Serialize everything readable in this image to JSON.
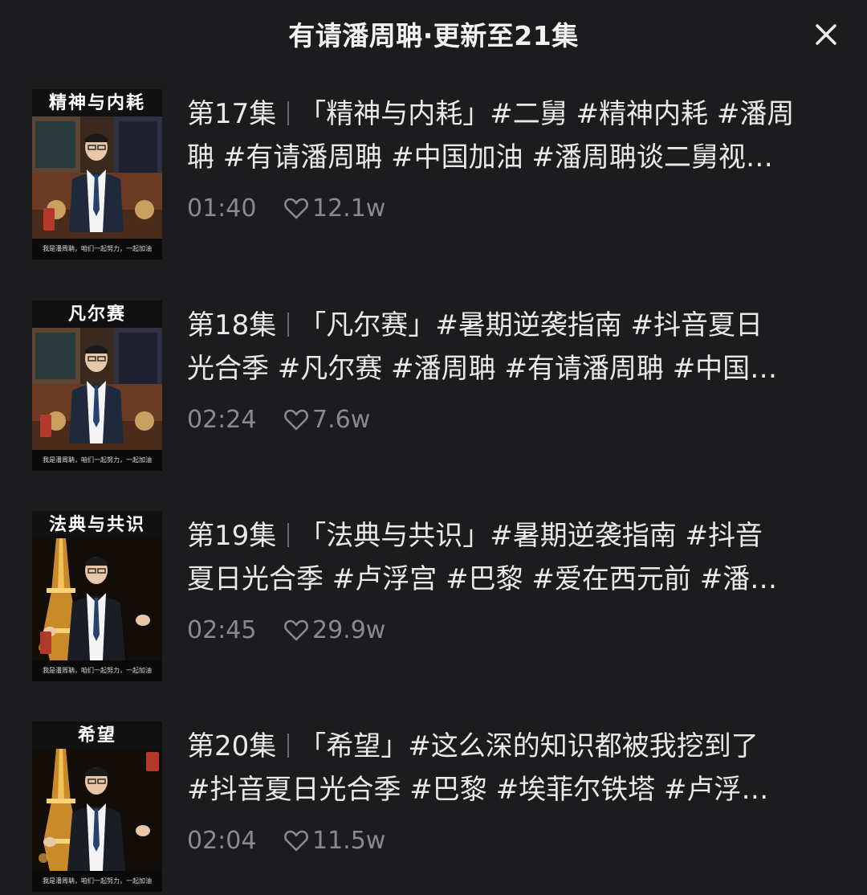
{
  "header": {
    "title": "有请潘周聃·更新至21集",
    "close_icon": "close-icon"
  },
  "thumb_caption": "我是潘周聃，咱们一起努力，一起加油",
  "episodes": [
    {
      "number": "第17集",
      "line1": "「精神与内耗」#二舅 #精神内耗 #潘周",
      "line2": "聃 #有请潘周聃 #中国加油 #潘周聃谈二舅视…",
      "duration": "01:40",
      "likes": "12.1w",
      "thumb_title": "精神与内耗",
      "thumb_scene": "library"
    },
    {
      "number": "第18集",
      "line1": "「凡尔赛」#暑期逆袭指南 #抖音夏日",
      "line2": "光合季 #凡尔赛 #潘周聃 #有请潘周聃 #中国…",
      "duration": "02:24",
      "likes": "7.6w",
      "thumb_title": "凡尔赛",
      "thumb_scene": "library"
    },
    {
      "number": "第19集",
      "line1": "「法典与共识」#暑期逆袭指南 #抖音",
      "line2": "夏日光合季 #卢浮宫 #巴黎 #爱在西元前 #潘…",
      "duration": "02:45",
      "likes": "29.9w",
      "thumb_title": "法典与共识",
      "thumb_scene": "tower"
    },
    {
      "number": "第20集",
      "line1": "「希望」#这么深的知识都被我挖到了",
      "line2": "#抖音夏日光合季 #巴黎 #埃菲尔铁塔 #卢浮…",
      "duration": "02:04",
      "likes": "11.5w",
      "thumb_title": "希望",
      "thumb_scene": "tower"
    }
  ],
  "colors": {
    "background": "#1c1c1e",
    "primary_text": "#e9e9ea",
    "secondary_text": "#8a8a8e"
  }
}
